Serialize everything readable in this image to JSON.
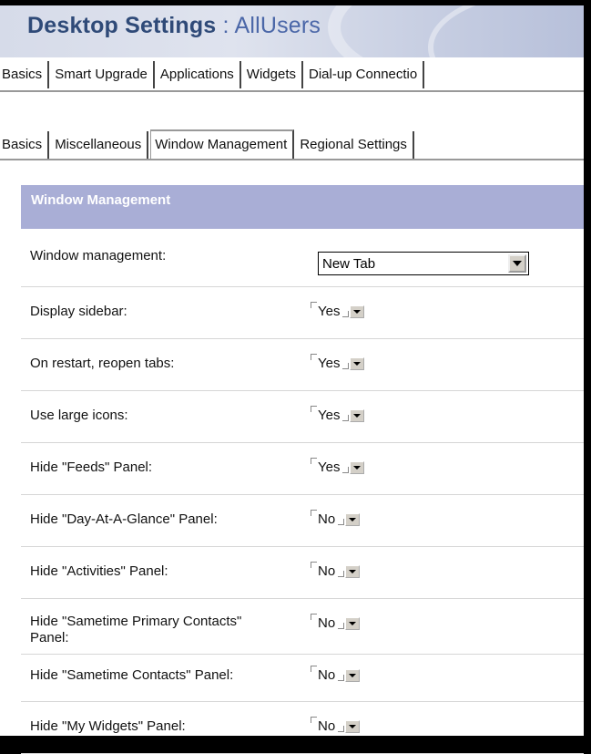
{
  "banner": {
    "title": "Desktop Settings",
    "separator": " : ",
    "subtitle": "AllUsers"
  },
  "tabs_primary": [
    "Basics",
    "Smart Upgrade",
    "Applications",
    "Widgets",
    "Dial-up Connectio"
  ],
  "tabs_secondary": [
    {
      "label": "Basics",
      "active": false
    },
    {
      "label": "Miscellaneous",
      "active": false
    },
    {
      "label": "Window Management",
      "active": true
    },
    {
      "label": "Regional Settings",
      "active": false
    }
  ],
  "section": {
    "title": "Window Management"
  },
  "fields": [
    {
      "label": "Window management:",
      "value": "New Tab"
    },
    {
      "label": "Display sidebar:",
      "value": "Yes"
    },
    {
      "label": "On restart, reopen tabs:",
      "value": "Yes"
    },
    {
      "label": "Use large icons:",
      "value": "Yes"
    },
    {
      "label": "Hide \"Feeds\" Panel:",
      "value": "Yes"
    },
    {
      "label": "Hide \"Day-At-A-Glance\" Panel:",
      "value": "No"
    },
    {
      "label": "Hide \"Activities\" Panel:",
      "value": "No"
    },
    {
      "label": "Hide \"Sametime Primary Contacts\" Panel:",
      "value": "No"
    },
    {
      "label": "Hide \"Sametime Contacts\" Panel:",
      "value": "No"
    },
    {
      "label": "Hide \"My Widgets\" Panel:",
      "value": "No"
    }
  ],
  "colors": {
    "banner_text": "#2f4a78",
    "section_header_bg": "#a9aed6"
  }
}
